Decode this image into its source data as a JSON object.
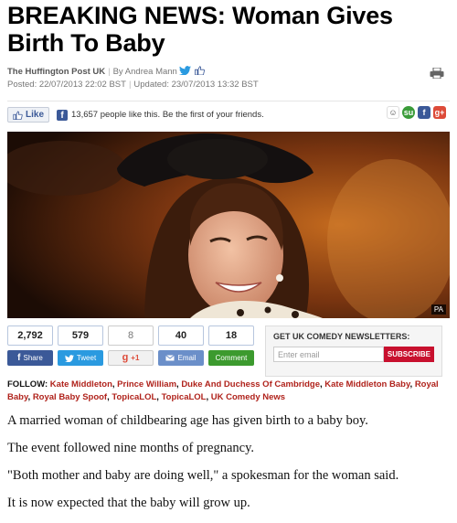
{
  "article": {
    "headline": "BREAKING NEWS: Woman Gives Birth To Baby",
    "source": "The Huffington Post UK",
    "author": "By Andrea Mann",
    "posted": "Posted: 22/07/2013 22:02 BST",
    "updated": "Updated: 23/07/2013 13:32 BST"
  },
  "facebook": {
    "like_label": "Like",
    "like_text": "13,657 people like this. Be the first of your friends."
  },
  "photo": {
    "credit": "PA"
  },
  "social": {
    "counts": [
      "2,792",
      "579",
      "8",
      "40",
      "18"
    ],
    "buttons": {
      "share": "Share",
      "tweet": "Tweet",
      "gplus": "+1",
      "email": "Email",
      "comment": "Comment"
    }
  },
  "newsletter": {
    "title": "GET UK COMEDY NEWSLETTERS:",
    "placeholder": "Enter email",
    "subscribe": "SUBSCRIBE"
  },
  "follow": {
    "label": "FOLLOW:",
    "tags": [
      "Kate Middleton",
      "Prince William",
      "Duke And Duchess Of Cambridge",
      "Kate Middleton Baby",
      "Royal Baby",
      "Royal Baby Spoof",
      "TopicaLOL",
      "TopicaLOL",
      "UK Comedy News"
    ]
  },
  "body": {
    "paragraphs": [
      "A married woman of childbearing age has given birth to a baby boy.",
      "The event followed nine months of pregnancy.",
      "\"Both mother and baby are doing well,\" a spokesman for the woman said.",
      "It is now expected that the baby will grow up."
    ]
  },
  "colors": {
    "accent_red": "#b0231c",
    "facebook_blue": "#3b5998",
    "twitter_blue": "#2a9ae0",
    "gplus_red": "#dd4b39",
    "comment_green": "#3c9a2e"
  }
}
